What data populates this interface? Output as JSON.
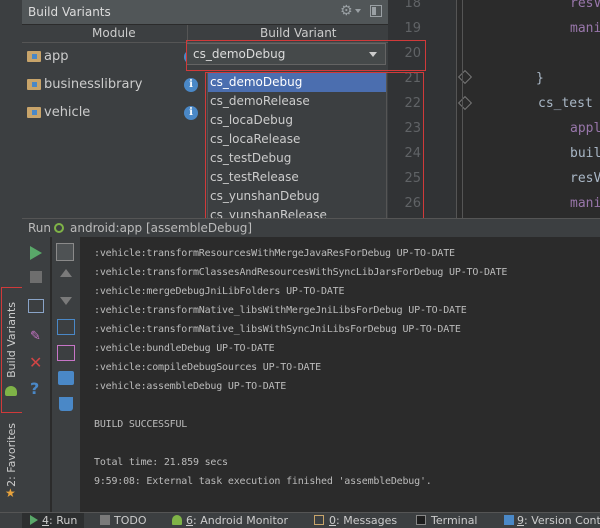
{
  "build_variants": {
    "title": "Build Variants",
    "columns": {
      "module": "Module",
      "variant": "Build Variant"
    },
    "modules": [
      {
        "name": "app"
      },
      {
        "name": "businesslibrary"
      },
      {
        "name": "vehicle"
      }
    ],
    "selected_variant": "cs_demoDebug",
    "options": [
      "cs_demoDebug",
      "cs_demoRelease",
      "cs_locaDebug",
      "cs_locaRelease",
      "cs_testDebug",
      "cs_testRelease",
      "cs_yunshanDebug",
      "cs_yunshanRelease"
    ]
  },
  "editor": {
    "line_numbers": [
      "18",
      "19",
      "20",
      "21",
      "22",
      "23",
      "24",
      "25",
      "26"
    ],
    "code": {
      "l18": "resV",
      "l19": "mani",
      "l21": "}",
      "l22": "cs_test {",
      "l23": "appl",
      "l24": "buil",
      "l25": "resV",
      "l26": "mani"
    }
  },
  "run": {
    "label": "Run",
    "config": "android:app [assembleDebug]",
    "console_lines": [
      ":vehicle:transformResourcesWithMergeJavaResForDebug UP-TO-DATE",
      ":vehicle:transformClassesAndResourcesWithSyncLibJarsForDebug UP-TO-DATE",
      ":vehicle:mergeDebugJniLibFolders UP-TO-DATE",
      ":vehicle:transformNative_libsWithMergeJniLibsForDebug UP-TO-DATE",
      ":vehicle:transformNative_libsWithSyncJniLibsForDebug UP-TO-DATE",
      ":vehicle:bundleDebug UP-TO-DATE",
      ":vehicle:compileDebugSources UP-TO-DATE",
      ":vehicle:assembleDebug UP-TO-DATE",
      "BUILD SUCCESSFUL",
      "Total time: 21.859 secs",
      "9:59:08: External task execution finished 'assembleDebug'."
    ]
  },
  "side_tabs": {
    "build_variants": "Build Variants",
    "favorites": "2: Favorites"
  },
  "bottom_bar": {
    "tabs": [
      {
        "num": "4",
        "label": ": Run"
      },
      {
        "label": "TODO"
      },
      {
        "num": "6",
        "label": ": Android Monitor"
      },
      {
        "num": "0",
        "label": ": Messages"
      },
      {
        "label": "Terminal"
      },
      {
        "num": "9",
        "label": ": Version Control"
      }
    ]
  },
  "colors": {
    "highlight_red": "#d03a3a",
    "selection_blue": "#4b6eaf",
    "panel": "#3c3f41",
    "editor_bg": "#2b2b2b"
  }
}
